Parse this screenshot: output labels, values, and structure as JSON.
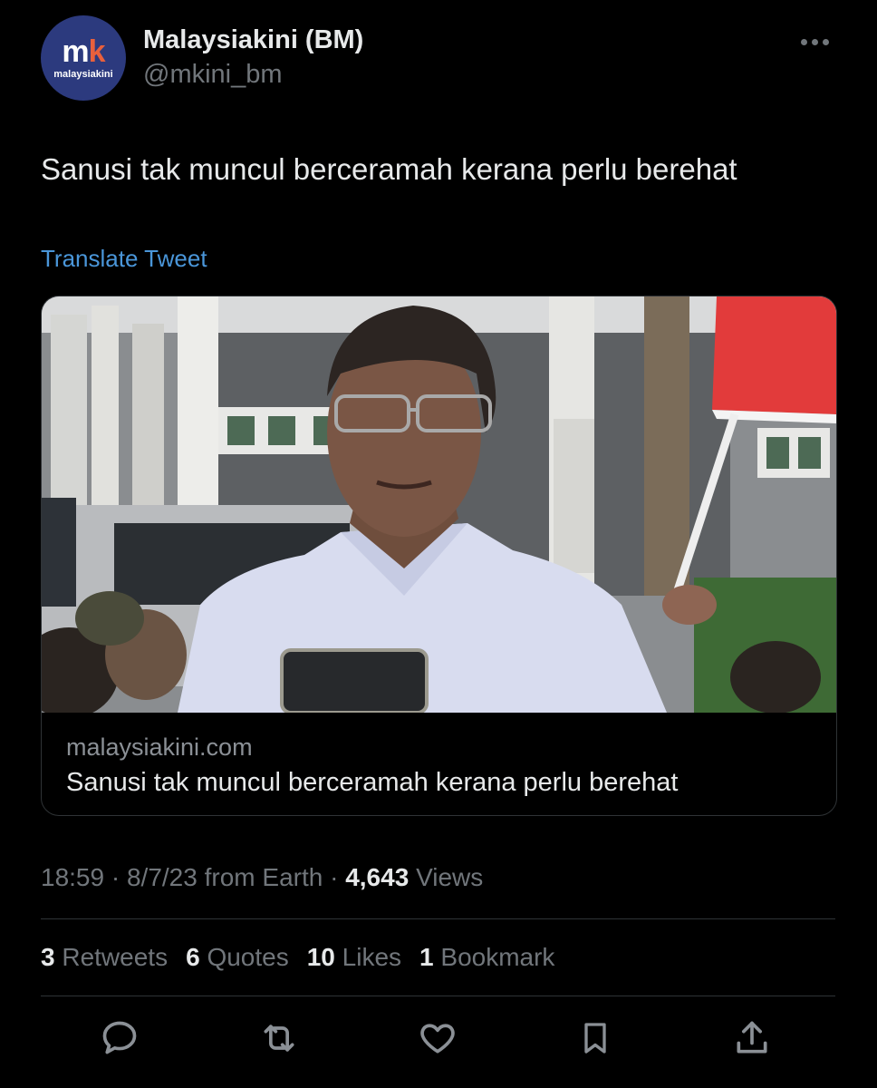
{
  "account": {
    "name": "Malaysiakini (BM)",
    "handle": "@mkini_bm",
    "avatar_mark_m": "m",
    "avatar_mark_k": "k",
    "avatar_wordmark": "malaysiakini"
  },
  "tweet": {
    "text": "Sanusi tak muncul berceramah kerana perlu berehat",
    "translate_label": "Translate Tweet"
  },
  "card": {
    "domain": "malaysiakini.com",
    "title": "Sanusi tak muncul berceramah kerana perlu berehat",
    "image_alt": "Man in glasses speaking to reporters in front of a building"
  },
  "meta": {
    "time": "18:59",
    "date": "8/7/23",
    "source": "from Earth",
    "views_count": "4,643",
    "views_label": "Views"
  },
  "stats": {
    "retweets_count": "3",
    "retweets_label": "Retweets",
    "quotes_count": "6",
    "quotes_label": "Quotes",
    "likes_count": "10",
    "likes_label": "Likes",
    "bookmarks_count": "1",
    "bookmarks_label": "Bookmark"
  },
  "actions": [
    "reply-icon",
    "retweet-icon",
    "like-icon",
    "bookmark-icon",
    "share-icon"
  ],
  "colors": {
    "background": "#000000",
    "link": "#4a96d9",
    "secondary": "#71767b",
    "avatar_bg": "#2c3a7e"
  }
}
